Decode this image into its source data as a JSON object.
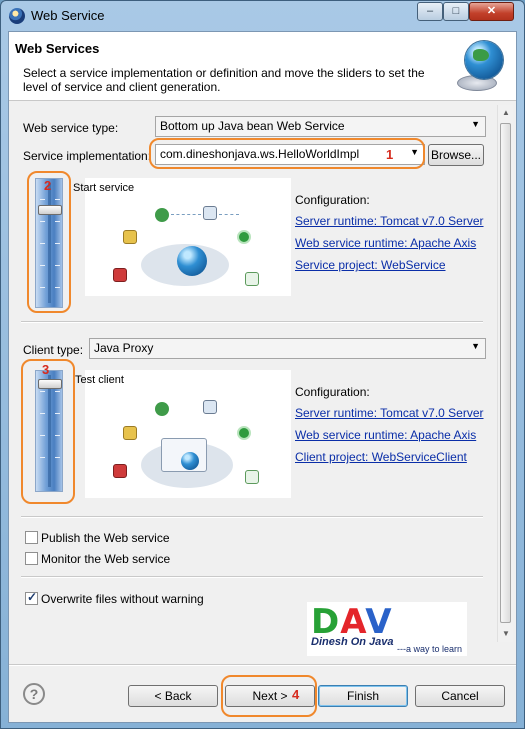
{
  "window": {
    "title": "Web Service",
    "minimize": "–",
    "maximize": "□",
    "close": "✕"
  },
  "header": {
    "title": "Web Services",
    "description": "Select a service implementation or definition and move the sliders to set the level of service and client generation."
  },
  "service": {
    "type_label": "Web service type:",
    "type_value": "Bottom up Java bean Web Service",
    "impl_label": "Service implementation:",
    "impl_value": "com.dineshonjava.ws.HelloWorldImpl",
    "browse_label": "Browse...",
    "slider_level_label": "Start service",
    "config_label": "Configuration:",
    "links": [
      "Server runtime: Tomcat v7.0 Server",
      "Web service runtime: Apache Axis",
      "Service project: WebService"
    ]
  },
  "client": {
    "type_label": "Client type:",
    "type_value": "Java Proxy",
    "slider_level_label": "Test client",
    "config_label": "Configuration:",
    "links": [
      "Server runtime: Tomcat v7.0 Server",
      "Web service runtime: Apache Axis",
      "Client project: WebServiceClient"
    ]
  },
  "options": {
    "publish": {
      "label": "Publish the Web service",
      "checked": false
    },
    "monitor": {
      "label": "Monitor the Web service",
      "checked": false
    },
    "overwrite": {
      "label": "Overwrite files without warning",
      "checked": true
    }
  },
  "annotations": [
    "1",
    "2",
    "3",
    "4"
  ],
  "logo": {
    "letters": "DAV",
    "subtitle": "Dinesh On Java",
    "tagline": "---a way to learn"
  },
  "footer": {
    "help": "?",
    "back": "< Back",
    "next": "Next >",
    "finish": "Finish",
    "cancel": "Cancel"
  },
  "icons": {
    "app": "web-service-icon",
    "header": "globe-icon",
    "diagram": "web-service-diagram",
    "accent_orange": "#f0882c",
    "annotation_red": "#d62b1e",
    "link_blue": "#0a2ea8"
  }
}
